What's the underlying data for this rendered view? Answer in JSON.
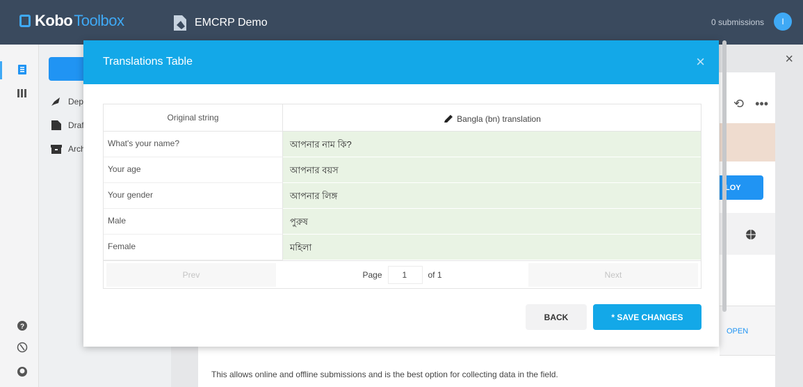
{
  "header": {
    "logo_bold": "Kobo",
    "logo_light": "Toolbox",
    "project_title": "EMCRP Demo",
    "submissions": "0 submissions",
    "avatar_initial": "I"
  },
  "sidebar": {
    "items": [
      {
        "label": "Dep",
        "icon": "rocket-icon"
      },
      {
        "label": "Draf",
        "icon": "draft-icon"
      },
      {
        "label": "Arch",
        "icon": "archive-icon"
      }
    ]
  },
  "background": {
    "deploy_label": "LOY",
    "open_label": "OPEN",
    "description": "This allows online and offline submissions and is the best option for collecting data in the field.",
    "close_glyph": "×"
  },
  "modal": {
    "title": "Translations Table",
    "close_glyph": "×",
    "table": {
      "col_original": "Original string",
      "col_translation": "Bangla (bn) translation",
      "rows": [
        {
          "original": "What's your name?",
          "translation": "আপনার নাম কি?"
        },
        {
          "original": "Your age",
          "translation": "আপনার বয়স"
        },
        {
          "original": "Your gender",
          "translation": "আপনার লিঙ্গ"
        },
        {
          "original": "Male",
          "translation": "পুরুষ"
        },
        {
          "original": "Female",
          "translation": "মহিলা"
        }
      ]
    },
    "pager": {
      "prev": "Prev",
      "page_label": "Page",
      "page_value": "1",
      "of_label": "of 1",
      "next": "Next"
    },
    "buttons": {
      "back": "BACK",
      "save": "* SAVE CHANGES"
    }
  },
  "colors": {
    "topbar": "#3a4a5e",
    "accent": "#13a8e8",
    "translation_cell": "#e9f3e4"
  }
}
